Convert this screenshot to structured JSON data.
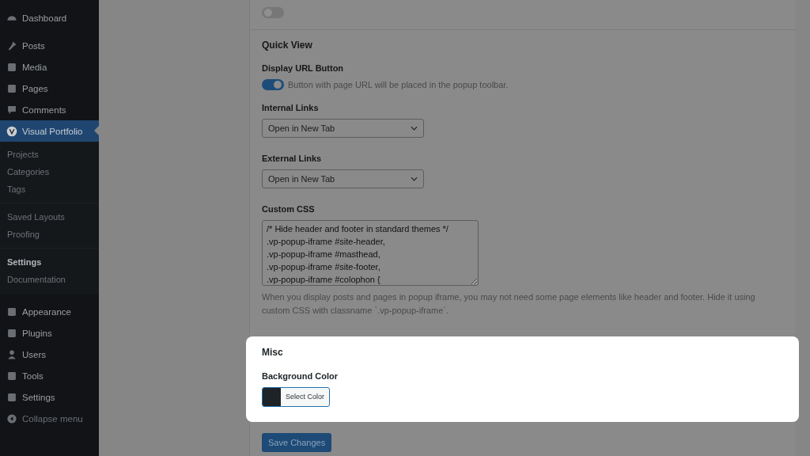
{
  "sidebar": {
    "items": [
      {
        "label": "Dashboard",
        "selected": false
      },
      {
        "label": "Posts",
        "selected": false
      },
      {
        "label": "Media",
        "selected": false
      },
      {
        "label": "Pages",
        "selected": false
      },
      {
        "label": "Comments",
        "selected": false
      },
      {
        "label": "Visual Portfolio",
        "selected": true,
        "submenu": [
          [
            {
              "label": "Projects",
              "selected": false
            },
            {
              "label": "Categories",
              "selected": false
            },
            {
              "label": "Tags",
              "selected": false
            }
          ],
          [
            {
              "label": "Saved Layouts",
              "selected": false
            },
            {
              "label": "Proofing",
              "selected": false
            }
          ],
          [
            {
              "label": "Settings",
              "selected": true
            },
            {
              "label": "Documentation",
              "selected": false
            }
          ]
        ]
      },
      {
        "label": "Appearance",
        "selected": false
      },
      {
        "label": "Plugins",
        "selected": false
      },
      {
        "label": "Users",
        "selected": false
      },
      {
        "label": "Tools",
        "selected": false
      },
      {
        "label": "Settings",
        "selected": false
      },
      {
        "label": "Collapse menu",
        "selected": false
      }
    ]
  },
  "top_toggle": {
    "on": false
  },
  "quick_view": {
    "title": "Quick View",
    "display_url_button": {
      "label": "Display URL Button",
      "on": true,
      "help": "Button with page URL will be placed in the popup toolbar."
    },
    "internal_links": {
      "label": "Internal Links",
      "value": "Open in New Tab"
    },
    "external_links": {
      "label": "External Links",
      "value": "Open in New Tab"
    },
    "custom_css": {
      "label": "Custom CSS",
      "value": "/* Hide header and footer in standard themes */\n.vp-popup-iframe #site-header,\n.vp-popup-iframe #masthead,\n.vp-popup-iframe #site-footer,\n.vp-popup-iframe #colophon {",
      "help": "When you display posts and pages in popup iframe, you may not need some page elements like header and footer. Hide it using custom CSS with classname `.vp-popup-iframe`."
    }
  },
  "misc": {
    "title": "Misc",
    "background_color": {
      "label": "Background Color",
      "color": "#1d2327",
      "button": "Select Color"
    }
  },
  "save_button": "Save Changes"
}
